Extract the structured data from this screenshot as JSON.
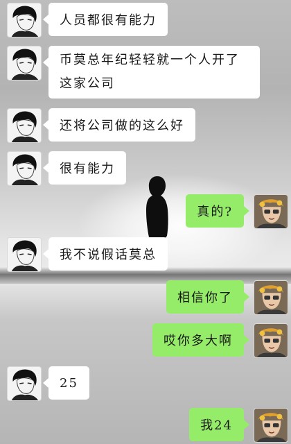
{
  "theme": {
    "incoming_bubble_color": "#ffffff",
    "outgoing_bubble_color": "#95ec69",
    "background_image": "lone figure silhouette on horizon"
  },
  "messages": [
    {
      "side": "left",
      "text": "人员都很有能力",
      "avatar": "contact-avatar"
    },
    {
      "side": "left",
      "text": "币莫总年纪轻轻就一个人开了这家公司",
      "avatar": "contact-avatar"
    },
    {
      "side": "left",
      "text": "还将公司做的这么好",
      "avatar": "contact-avatar"
    },
    {
      "side": "left",
      "text": "很有能力",
      "avatar": "contact-avatar"
    },
    {
      "side": "right",
      "text": "真的?",
      "avatar": "user-avatar"
    },
    {
      "side": "left",
      "text": "我不说假话莫总",
      "avatar": "contact-avatar"
    },
    {
      "side": "right",
      "text": "相信你了",
      "avatar": "user-avatar"
    },
    {
      "side": "right",
      "text": "哎你多大啊",
      "avatar": "user-avatar"
    },
    {
      "side": "left",
      "text": "25",
      "avatar": "contact-avatar"
    },
    {
      "side": "right",
      "text": "我24",
      "avatar": "user-avatar"
    }
  ]
}
